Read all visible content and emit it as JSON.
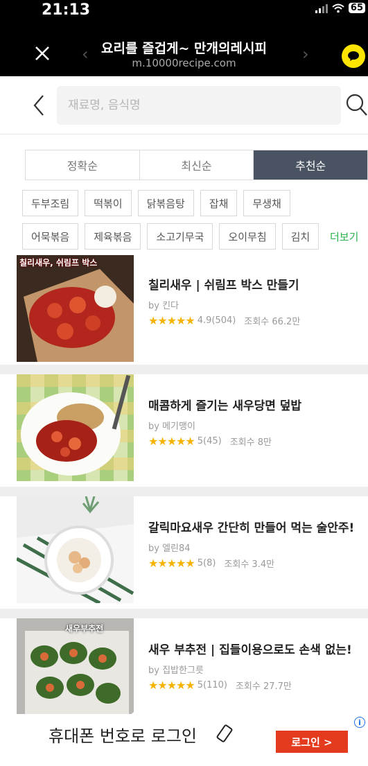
{
  "status": {
    "time": "21:13",
    "battery": "65"
  },
  "browser": {
    "title": "요리를 즐겁게~ 만개의레시피",
    "url": "m.10000recipe.com"
  },
  "search": {
    "placeholder": "재료명, 음식명",
    "value": ""
  },
  "sort_tabs": [
    {
      "label": "정확순",
      "active": false
    },
    {
      "label": "최신순",
      "active": false
    },
    {
      "label": "추천순",
      "active": true
    }
  ],
  "chips_row1": [
    "두부조림",
    "떡볶이",
    "닭볶음탕",
    "잡채",
    "무생채"
  ],
  "chips_row2": [
    "어묵볶음",
    "제육볶음",
    "소고기무국",
    "오이무침",
    "김치"
  ],
  "more_label": "더보기",
  "recipes": [
    {
      "title": "칠리새우 | 쉬림프 박스 만들기",
      "author": "by 킨다",
      "rating": "4.9",
      "reviews": "(504)",
      "views": "조회수 66.2만",
      "caption": "칠리새우, 쉬림프 박스"
    },
    {
      "title": "매콤하게 즐기는 새우당면 덮밥",
      "author": "by 메기맹이",
      "rating": "5",
      "reviews": "(45)",
      "views": "조회수 8만",
      "caption": ""
    },
    {
      "title": "갈릭마요새우 간단히 만들어 먹는 술안주!",
      "author": "by 엘린84",
      "rating": "5",
      "reviews": "(8)",
      "views": "조회수 3.4만",
      "caption": ""
    },
    {
      "title": "새우 부추전 | 집들이용으로도 손색 없는!",
      "author": "by 집밥한그릇",
      "rating": "5",
      "reviews": "(110)",
      "views": "조회수 27.7만",
      "caption": "새우부추전"
    }
  ],
  "stars": "★★★★★",
  "login": {
    "text": "휴대폰 번호로 로그인",
    "button": "로그인 >",
    "info": "i"
  }
}
